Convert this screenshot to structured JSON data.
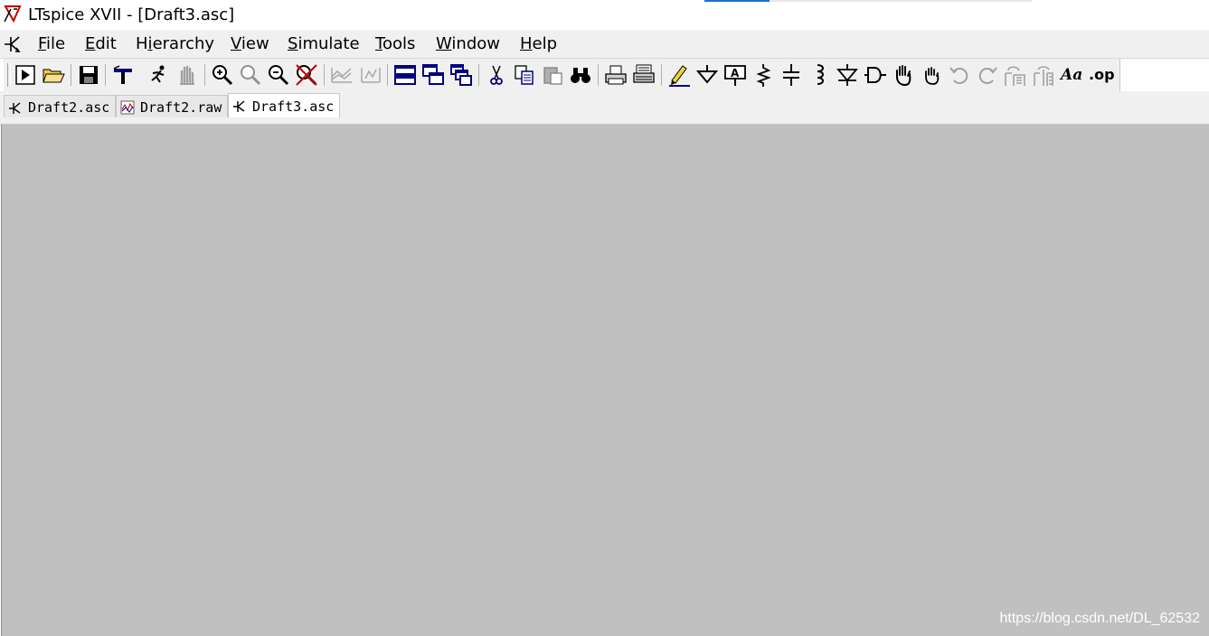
{
  "window": {
    "title": "LTspice XVII - [Draft3.asc]"
  },
  "menu": {
    "items": [
      "File",
      "Edit",
      "Hierarchy",
      "View",
      "Simulate",
      "Tools",
      "Window",
      "Help"
    ]
  },
  "toolbar": {
    "text_buttons": {
      "text_label": "Aa",
      "spice_directive_label": ".op"
    },
    "icons": [
      "run-icon",
      "open-icon",
      "save-icon",
      "control-panel-icon",
      "halt-icon",
      "pan-icon",
      "zoom-in-icon",
      "zoom-area-icon",
      "zoom-out-icon",
      "zoom-fit-icon",
      "autorange-icon",
      "autorange-x-icon",
      "tile-horizontal-icon",
      "cascade-icon",
      "tile-vertical-icon",
      "cut-icon",
      "copy-icon",
      "paste-icon",
      "find-icon",
      "print-preview-icon",
      "print-icon",
      "wire-pencil-icon",
      "ground-icon",
      "label-net-icon",
      "resistor-icon",
      "capacitor-icon",
      "inductor-icon",
      "diode-icon",
      "component-icon",
      "move-hand-icon",
      "drag-hand-icon",
      "undo-icon",
      "redo-icon",
      "rotate-icon",
      "mirror-icon"
    ]
  },
  "tabs": [
    {
      "label": "Draft2.asc",
      "icon": "schematic-icon",
      "active": false
    },
    {
      "label": "Draft2.raw",
      "icon": "waveform-icon",
      "active": false
    },
    {
      "label": "Draft3.asc",
      "icon": "schematic-icon",
      "active": true
    }
  ],
  "workspace": {
    "background": "#c0c0c0",
    "watermark": "https://blog.csdn.net/DL_62532"
  },
  "colors": {
    "title_accent": "#1b6fd6",
    "icon_blue": "#000080",
    "icon_red": "#c00000"
  }
}
